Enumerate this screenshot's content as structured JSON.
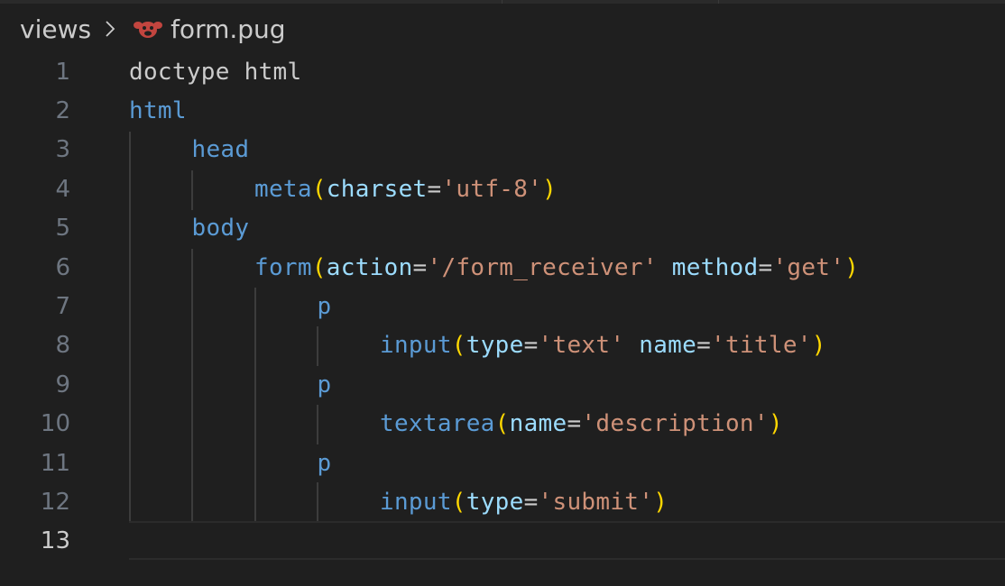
{
  "breadcrumb": {
    "folder": "views",
    "file_icon": "pug-icon",
    "file": "form.pug"
  },
  "editor": {
    "active_line": "13",
    "lines": [
      {
        "num": "1",
        "tokens": [
          {
            "t": "kw",
            "v": "doctype html"
          }
        ]
      },
      {
        "num": "2",
        "tokens": [
          {
            "t": "tag",
            "v": "html"
          }
        ]
      },
      {
        "num": "3",
        "tokens": [
          {
            "t": "tag",
            "v": "head"
          }
        ]
      },
      {
        "num": "4",
        "tokens": [
          {
            "t": "tag",
            "v": "meta"
          },
          {
            "t": "paren",
            "v": "("
          },
          {
            "t": "attr",
            "v": "charset"
          },
          {
            "t": "op",
            "v": "="
          },
          {
            "t": "str",
            "v": "'utf-8'"
          },
          {
            "t": "paren",
            "v": ")"
          }
        ]
      },
      {
        "num": "5",
        "tokens": [
          {
            "t": "tag",
            "v": "body"
          }
        ]
      },
      {
        "num": "6",
        "tokens": [
          {
            "t": "tag",
            "v": "form"
          },
          {
            "t": "paren",
            "v": "("
          },
          {
            "t": "attr",
            "v": "action"
          },
          {
            "t": "op",
            "v": "="
          },
          {
            "t": "str",
            "v": "'/form_receiver'"
          },
          {
            "t": "op",
            "v": " "
          },
          {
            "t": "attr",
            "v": "method"
          },
          {
            "t": "op",
            "v": "="
          },
          {
            "t": "str",
            "v": "'get'"
          },
          {
            "t": "paren",
            "v": ")"
          }
        ]
      },
      {
        "num": "7",
        "tokens": [
          {
            "t": "tag",
            "v": "p"
          }
        ]
      },
      {
        "num": "8",
        "tokens": [
          {
            "t": "tag",
            "v": "input"
          },
          {
            "t": "paren",
            "v": "("
          },
          {
            "t": "attr",
            "v": "type"
          },
          {
            "t": "op",
            "v": "="
          },
          {
            "t": "str",
            "v": "'text'"
          },
          {
            "t": "op",
            "v": " "
          },
          {
            "t": "attr",
            "v": "name"
          },
          {
            "t": "op",
            "v": "="
          },
          {
            "t": "str",
            "v": "'title'"
          },
          {
            "t": "paren",
            "v": ")"
          }
        ]
      },
      {
        "num": "9",
        "tokens": [
          {
            "t": "tag",
            "v": "p"
          }
        ]
      },
      {
        "num": "10",
        "tokens": [
          {
            "t": "tag",
            "v": "textarea"
          },
          {
            "t": "paren",
            "v": "("
          },
          {
            "t": "attr",
            "v": "name"
          },
          {
            "t": "op",
            "v": "="
          },
          {
            "t": "str",
            "v": "'description'"
          },
          {
            "t": "paren",
            "v": ")"
          }
        ]
      },
      {
        "num": "11",
        "tokens": [
          {
            "t": "tag",
            "v": "p"
          }
        ]
      },
      {
        "num": "12",
        "tokens": [
          {
            "t": "tag",
            "v": "input"
          },
          {
            "t": "paren",
            "v": "("
          },
          {
            "t": "attr",
            "v": "type"
          },
          {
            "t": "op",
            "v": "="
          },
          {
            "t": "str",
            "v": "'submit'"
          },
          {
            "t": "paren",
            "v": ")"
          }
        ]
      },
      {
        "num": "13",
        "tokens": []
      }
    ]
  }
}
